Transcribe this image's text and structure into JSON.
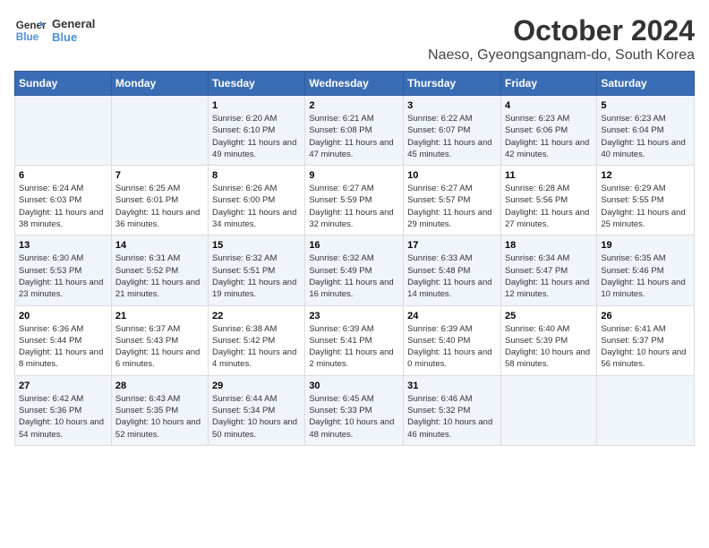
{
  "logo": {
    "line1": "General",
    "line2": "Blue"
  },
  "title": "October 2024",
  "location": "Naeso, Gyeongsangnam-do, South Korea",
  "days_of_week": [
    "Sunday",
    "Monday",
    "Tuesday",
    "Wednesday",
    "Thursday",
    "Friday",
    "Saturday"
  ],
  "weeks": [
    [
      {
        "num": "",
        "sunrise": "",
        "sunset": "",
        "daylight": ""
      },
      {
        "num": "",
        "sunrise": "",
        "sunset": "",
        "daylight": ""
      },
      {
        "num": "1",
        "sunrise": "Sunrise: 6:20 AM",
        "sunset": "Sunset: 6:10 PM",
        "daylight": "Daylight: 11 hours and 49 minutes."
      },
      {
        "num": "2",
        "sunrise": "Sunrise: 6:21 AM",
        "sunset": "Sunset: 6:08 PM",
        "daylight": "Daylight: 11 hours and 47 minutes."
      },
      {
        "num": "3",
        "sunrise": "Sunrise: 6:22 AM",
        "sunset": "Sunset: 6:07 PM",
        "daylight": "Daylight: 11 hours and 45 minutes."
      },
      {
        "num": "4",
        "sunrise": "Sunrise: 6:23 AM",
        "sunset": "Sunset: 6:06 PM",
        "daylight": "Daylight: 11 hours and 42 minutes."
      },
      {
        "num": "5",
        "sunrise": "Sunrise: 6:23 AM",
        "sunset": "Sunset: 6:04 PM",
        "daylight": "Daylight: 11 hours and 40 minutes."
      }
    ],
    [
      {
        "num": "6",
        "sunrise": "Sunrise: 6:24 AM",
        "sunset": "Sunset: 6:03 PM",
        "daylight": "Daylight: 11 hours and 38 minutes."
      },
      {
        "num": "7",
        "sunrise": "Sunrise: 6:25 AM",
        "sunset": "Sunset: 6:01 PM",
        "daylight": "Daylight: 11 hours and 36 minutes."
      },
      {
        "num": "8",
        "sunrise": "Sunrise: 6:26 AM",
        "sunset": "Sunset: 6:00 PM",
        "daylight": "Daylight: 11 hours and 34 minutes."
      },
      {
        "num": "9",
        "sunrise": "Sunrise: 6:27 AM",
        "sunset": "Sunset: 5:59 PM",
        "daylight": "Daylight: 11 hours and 32 minutes."
      },
      {
        "num": "10",
        "sunrise": "Sunrise: 6:27 AM",
        "sunset": "Sunset: 5:57 PM",
        "daylight": "Daylight: 11 hours and 29 minutes."
      },
      {
        "num": "11",
        "sunrise": "Sunrise: 6:28 AM",
        "sunset": "Sunset: 5:56 PM",
        "daylight": "Daylight: 11 hours and 27 minutes."
      },
      {
        "num": "12",
        "sunrise": "Sunrise: 6:29 AM",
        "sunset": "Sunset: 5:55 PM",
        "daylight": "Daylight: 11 hours and 25 minutes."
      }
    ],
    [
      {
        "num": "13",
        "sunrise": "Sunrise: 6:30 AM",
        "sunset": "Sunset: 5:53 PM",
        "daylight": "Daylight: 11 hours and 23 minutes."
      },
      {
        "num": "14",
        "sunrise": "Sunrise: 6:31 AM",
        "sunset": "Sunset: 5:52 PM",
        "daylight": "Daylight: 11 hours and 21 minutes."
      },
      {
        "num": "15",
        "sunrise": "Sunrise: 6:32 AM",
        "sunset": "Sunset: 5:51 PM",
        "daylight": "Daylight: 11 hours and 19 minutes."
      },
      {
        "num": "16",
        "sunrise": "Sunrise: 6:32 AM",
        "sunset": "Sunset: 5:49 PM",
        "daylight": "Daylight: 11 hours and 16 minutes."
      },
      {
        "num": "17",
        "sunrise": "Sunrise: 6:33 AM",
        "sunset": "Sunset: 5:48 PM",
        "daylight": "Daylight: 11 hours and 14 minutes."
      },
      {
        "num": "18",
        "sunrise": "Sunrise: 6:34 AM",
        "sunset": "Sunset: 5:47 PM",
        "daylight": "Daylight: 11 hours and 12 minutes."
      },
      {
        "num": "19",
        "sunrise": "Sunrise: 6:35 AM",
        "sunset": "Sunset: 5:46 PM",
        "daylight": "Daylight: 11 hours and 10 minutes."
      }
    ],
    [
      {
        "num": "20",
        "sunrise": "Sunrise: 6:36 AM",
        "sunset": "Sunset: 5:44 PM",
        "daylight": "Daylight: 11 hours and 8 minutes."
      },
      {
        "num": "21",
        "sunrise": "Sunrise: 6:37 AM",
        "sunset": "Sunset: 5:43 PM",
        "daylight": "Daylight: 11 hours and 6 minutes."
      },
      {
        "num": "22",
        "sunrise": "Sunrise: 6:38 AM",
        "sunset": "Sunset: 5:42 PM",
        "daylight": "Daylight: 11 hours and 4 minutes."
      },
      {
        "num": "23",
        "sunrise": "Sunrise: 6:39 AM",
        "sunset": "Sunset: 5:41 PM",
        "daylight": "Daylight: 11 hours and 2 minutes."
      },
      {
        "num": "24",
        "sunrise": "Sunrise: 6:39 AM",
        "sunset": "Sunset: 5:40 PM",
        "daylight": "Daylight: 11 hours and 0 minutes."
      },
      {
        "num": "25",
        "sunrise": "Sunrise: 6:40 AM",
        "sunset": "Sunset: 5:39 PM",
        "daylight": "Daylight: 10 hours and 58 minutes."
      },
      {
        "num": "26",
        "sunrise": "Sunrise: 6:41 AM",
        "sunset": "Sunset: 5:37 PM",
        "daylight": "Daylight: 10 hours and 56 minutes."
      }
    ],
    [
      {
        "num": "27",
        "sunrise": "Sunrise: 6:42 AM",
        "sunset": "Sunset: 5:36 PM",
        "daylight": "Daylight: 10 hours and 54 minutes."
      },
      {
        "num": "28",
        "sunrise": "Sunrise: 6:43 AM",
        "sunset": "Sunset: 5:35 PM",
        "daylight": "Daylight: 10 hours and 52 minutes."
      },
      {
        "num": "29",
        "sunrise": "Sunrise: 6:44 AM",
        "sunset": "Sunset: 5:34 PM",
        "daylight": "Daylight: 10 hours and 50 minutes."
      },
      {
        "num": "30",
        "sunrise": "Sunrise: 6:45 AM",
        "sunset": "Sunset: 5:33 PM",
        "daylight": "Daylight: 10 hours and 48 minutes."
      },
      {
        "num": "31",
        "sunrise": "Sunrise: 6:46 AM",
        "sunset": "Sunset: 5:32 PM",
        "daylight": "Daylight: 10 hours and 46 minutes."
      },
      {
        "num": "",
        "sunrise": "",
        "sunset": "",
        "daylight": ""
      },
      {
        "num": "",
        "sunrise": "",
        "sunset": "",
        "daylight": ""
      }
    ]
  ]
}
